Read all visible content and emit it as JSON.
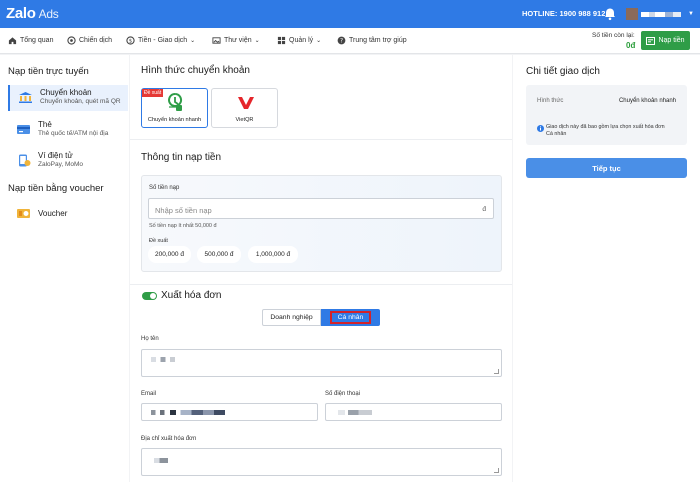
{
  "header": {
    "logo": "Zalo",
    "logo_suffix": "Ads",
    "hotline": "HOTLINE: 1900 988 912"
  },
  "nav": {
    "items": [
      "Tổng quan",
      "Chiến dịch",
      "Tiền - Giao dịch",
      "Thư viện",
      "Quản lý",
      "Trung tâm trợ giúp"
    ],
    "balance_label": "Số tiền còn lại:",
    "balance_value": "0đ",
    "topup_button": "Nạp tiền"
  },
  "sidebar": {
    "section1": "Nạp tiền trực tuyến",
    "items": [
      {
        "title": "Chuyển khoản",
        "sub": "Chuyển khoản, quét mã QR"
      },
      {
        "title": "Thẻ",
        "sub": "Thẻ quốc tế/ATM nội địa"
      },
      {
        "title": "Ví điện tử",
        "sub": "ZaloPay, MoMo"
      }
    ],
    "section2": "Nạp tiền bằng voucher",
    "voucher": "Voucher"
  },
  "main": {
    "method_title": "Hình thức chuyển khoản",
    "methods": [
      {
        "label": "Chuyển khoản nhanh",
        "badge": "Đề xuất"
      },
      {
        "label": "VietQR"
      }
    ],
    "info_title": "Thông tin nạp tiền",
    "amount_label": "Số tiền nạp",
    "amount_placeholder": "Nhập số tiền nạp",
    "amount_unit": "đ",
    "amount_hint": "Số tiền nạp ít nhất 50,000 đ",
    "suggest_label": "Đề xuất",
    "suggestions": [
      "200,000 đ",
      "500,000 đ",
      "1,000,000 đ"
    ],
    "invoice_title": "Xuất hóa đơn",
    "invoice_types": [
      "Doanh nghiệp",
      "Cá nhân"
    ],
    "name_label": "Họ tên",
    "email_label": "Email",
    "phone_label": "Số điện thoại",
    "address_label": "Địa chỉ xuất hóa đơn"
  },
  "detail": {
    "title": "Chi tiết giao dịch",
    "method_label": "Hình thức",
    "method_value": "Chuyển khoản nhanh",
    "note": "Giao dịch này đã bao gồm lựa chọn xuất hóa đơn Cá nhân",
    "continue_button": "Tiếp tục"
  },
  "colors": {
    "brand": "#2f7ae5",
    "green": "#2f9d47",
    "highlight": "#d3222a"
  }
}
